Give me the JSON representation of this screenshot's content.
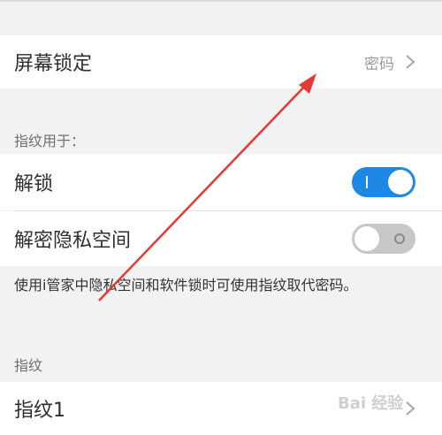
{
  "screen_lock": {
    "label": "屏幕锁定",
    "value": "密码"
  },
  "fingerprint_for": {
    "section_label": "指纹用于：",
    "unlock": {
      "label": "解锁",
      "enabled": true
    },
    "private_space": {
      "label": "解密隐私空间",
      "enabled": false
    }
  },
  "note": "使用i管家中隐私空间和软件锁时可使用指纹取代密码。",
  "fingerprints": {
    "section_label": "指纹",
    "items": [
      {
        "label": "指纹1"
      }
    ]
  },
  "watermark": "Bai 经验",
  "colors": {
    "toggle_on": "#1e88e5",
    "toggle_off": "#c7c7c7",
    "annotation_arrow": "#e53935"
  },
  "icons": {
    "chevron": "chevron-right-icon"
  }
}
